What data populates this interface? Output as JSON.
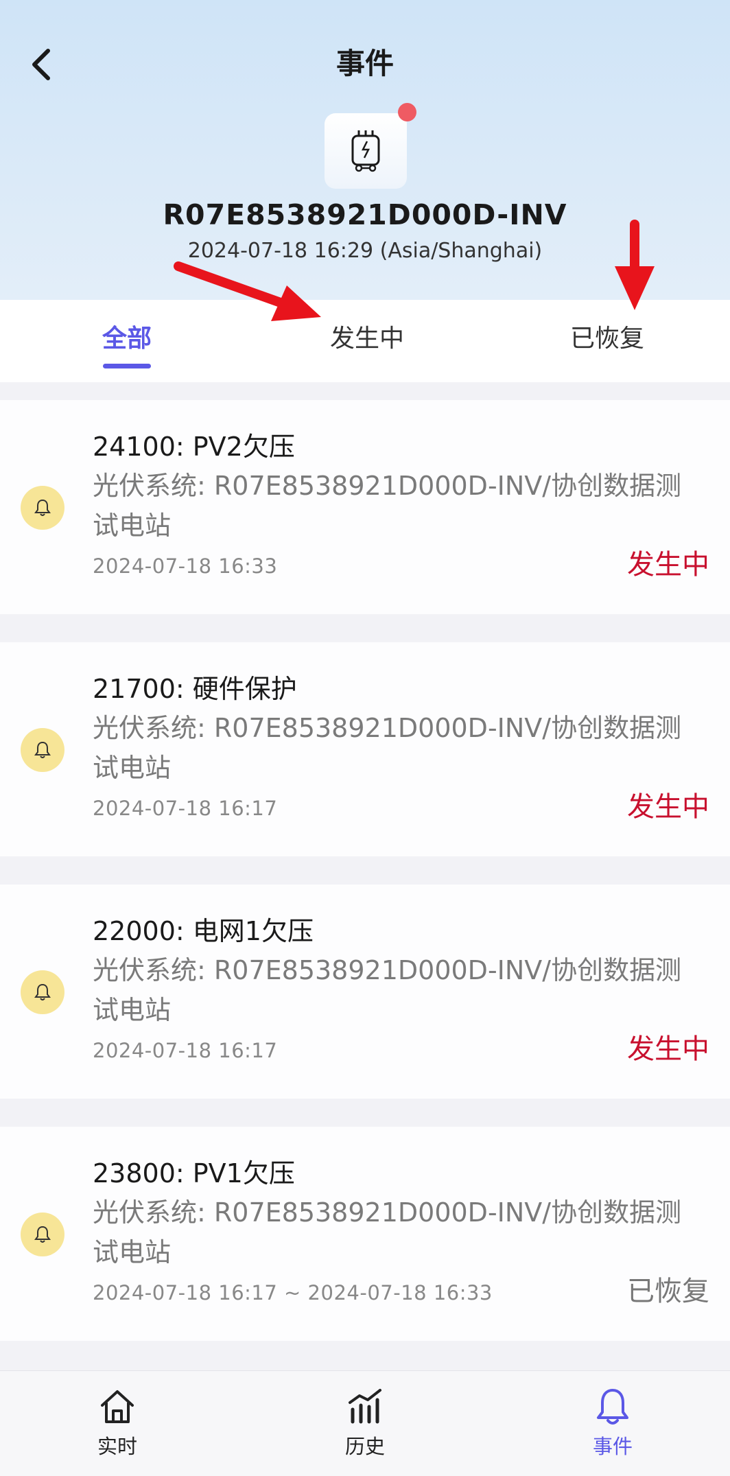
{
  "header": {
    "title": "事件",
    "device_id": "R07E8538921D000D-INV",
    "device_time": "2024-07-18 16:29 (Asia/Shanghai)",
    "device_icon": "inverter-icon",
    "alert_color": "#ef5b63"
  },
  "tabs": [
    {
      "label": "全部",
      "active": true
    },
    {
      "label": "发生中",
      "active": false
    },
    {
      "label": "已恢复",
      "active": false
    }
  ],
  "events": [
    {
      "title": "24100: PV2欠压",
      "description": "光伏系统: R07E8538921D000D-INV/协创数据测试电站",
      "time": "2024-07-18 16:33",
      "status": "发生中",
      "status_type": "active"
    },
    {
      "title": "21700: 硬件保护",
      "description": "光伏系统: R07E8538921D000D-INV/协创数据测试电站",
      "time": "2024-07-18 16:17",
      "status": "发生中",
      "status_type": "active"
    },
    {
      "title": "22000: 电网1欠压",
      "description": "光伏系统: R07E8538921D000D-INV/协创数据测试电站",
      "time": "2024-07-18 16:17",
      "status": "发生中",
      "status_type": "active"
    },
    {
      "title": "23800: PV1欠压",
      "description": "光伏系统: R07E8538921D000D-INV/协创数据测试电站",
      "time": "2024-07-18 16:17 ~ 2024-07-18 16:33",
      "status": "已恢复",
      "status_type": "recovered"
    }
  ],
  "bottom_nav": [
    {
      "label": "实时",
      "icon": "home-icon",
      "active": false
    },
    {
      "label": "历史",
      "icon": "chart-icon",
      "active": false
    },
    {
      "label": "事件",
      "icon": "bell-icon",
      "active": true
    }
  ],
  "colors": {
    "accent": "#5b58e6",
    "status_active": "#c8102e",
    "status_recovered": "#777777",
    "bell_badge": "#f7e597",
    "annotation_arrow": "#e8141c"
  }
}
